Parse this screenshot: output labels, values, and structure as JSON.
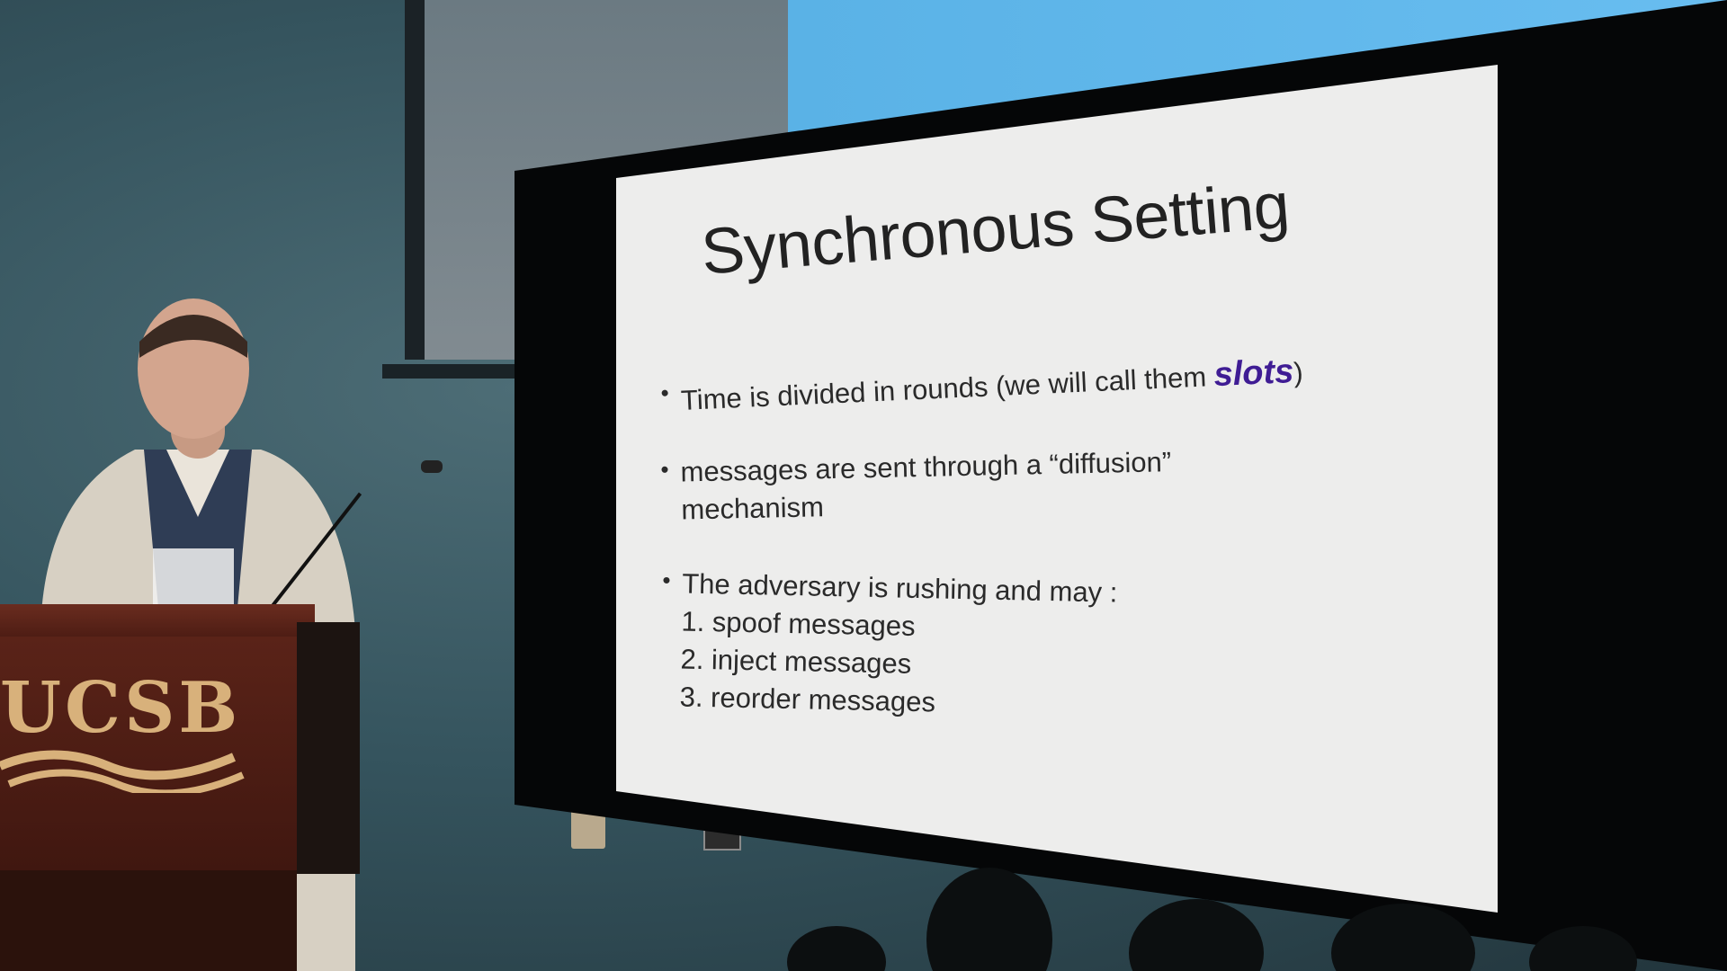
{
  "scene": {
    "slide_title": "Synchronous Setting",
    "bullets": [
      {
        "marker": "•",
        "text_before": "Time is divided in rounds (we will call them ",
        "emphasis": "slots",
        "text_after": ")"
      },
      {
        "marker": "•",
        "line1": "messages are sent through a “diffusion”",
        "line2": "mechanism"
      },
      {
        "marker": "•",
        "line1": "The adversary is rushing and may :",
        "sub_items": [
          "1. spoof messages",
          "2. inject messages",
          "3. reorder messages"
        ]
      }
    ],
    "podium_logo": "UCSB",
    "colors": {
      "slide_background": "#ededec",
      "emphasis": "#3f1c94",
      "podium_wood": "#5a2318",
      "logo_gold": "#d8b17b",
      "blue_screen": "#5ab2e6"
    }
  }
}
